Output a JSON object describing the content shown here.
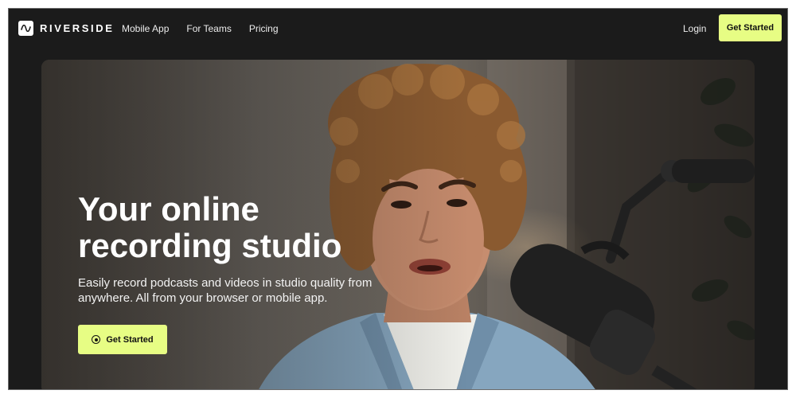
{
  "brand": {
    "name": "RIVERSIDE",
    "logo_icon": "wave-icon"
  },
  "nav": {
    "links": [
      "Mobile App",
      "For Teams",
      "Pricing"
    ],
    "login": "Login",
    "cta": "Get Started"
  },
  "hero": {
    "title": "Your online recording studio",
    "subtitle": "Easily record podcasts and videos in studio quality from anywhere. All from your browser or mobile app.",
    "cta": "Get Started",
    "cta_icon": "record-icon",
    "image": "woman-speaking-into-microphone-photo"
  },
  "colors": {
    "accent": "#e7fd84",
    "background": "#1b1b1b",
    "text": "#ffffff"
  }
}
